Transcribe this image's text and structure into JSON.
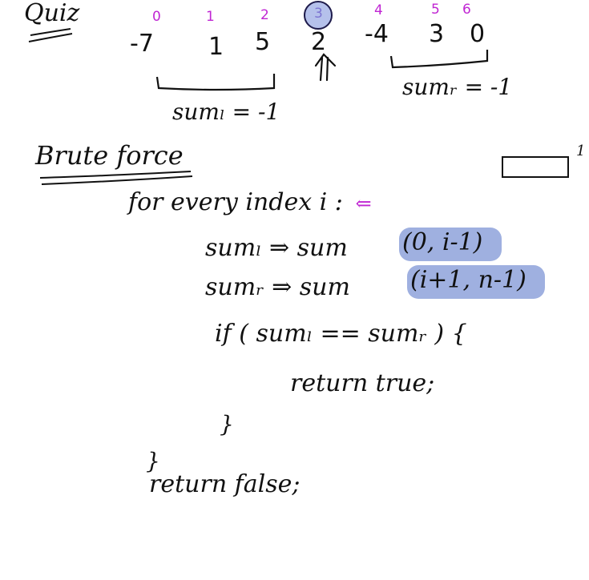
{
  "title": "Quiz",
  "indices": [
    "0",
    "1",
    "2",
    "3",
    "4",
    "5",
    "6"
  ],
  "values": [
    "-7",
    "1",
    "5",
    "2",
    "-4",
    "3",
    "0"
  ],
  "sum_left": "sumₗ = -1",
  "sum_right": "sumᵣ = -1",
  "section": "Brute force",
  "margin_mark": "1",
  "code": {
    "line1": "for every index i :",
    "line2a": "sumₗ ⇒ sum",
    "line2b": "(0, i-1)",
    "line3a": "sumᵣ ⇒ sum",
    "line3b": "(i+1, n-1)",
    "line4": "if ( sumₗ == sumᵣ ) {",
    "line5": "return true;",
    "line6": "}",
    "line7": "}",
    "line8": "return false;"
  },
  "colors": {
    "ink": "#111111",
    "index_ink": "#c026d3",
    "highlight": "#9fb0e0",
    "circle_fill": "#8ea0e0"
  }
}
